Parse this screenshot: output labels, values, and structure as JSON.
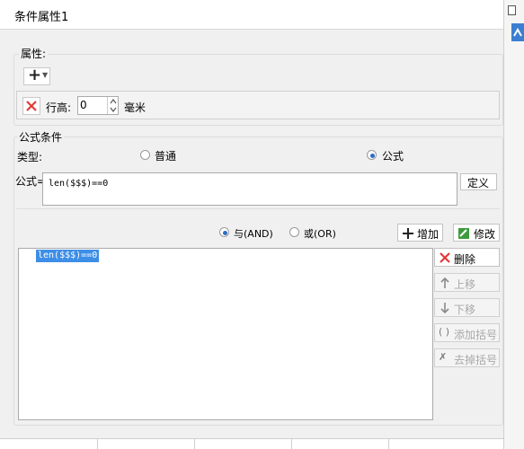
{
  "window": {
    "title": "条件属性1"
  },
  "properties": {
    "group_label": "属性:",
    "row_height_label": "行高:",
    "row_height_value": "0",
    "unit_label": "毫米"
  },
  "formula_condition": {
    "group_label": "公式条件",
    "type_label": "类型:",
    "type_options": [
      {
        "label": "普通",
        "selected": false
      },
      {
        "label": "公式",
        "selected": true
      }
    ],
    "formula_label": "公式=",
    "formula_value": "len($$$)==0",
    "define_button": "定义",
    "logic_options": [
      {
        "label": "与(AND)",
        "selected": true
      },
      {
        "label": "或(OR)",
        "selected": false
      }
    ],
    "add_button": "增加",
    "modify_button": "修改",
    "conditions": [
      "len($$$)==0"
    ],
    "side_buttons": [
      {
        "label": "删除",
        "enabled": true,
        "icon": "red-x-icon"
      },
      {
        "label": "上移",
        "enabled": false,
        "icon": "arrow-up-icon"
      },
      {
        "label": "下移",
        "enabled": false,
        "icon": "arrow-down-icon"
      },
      {
        "label": "添加括号",
        "enabled": false,
        "icon": "parentheses-icon"
      },
      {
        "label": "去掉括号",
        "enabled": false,
        "icon": "remove-parentheses-icon"
      }
    ]
  },
  "colors": {
    "accent": "#3d8ee6",
    "delete_red": "#e53935",
    "radio_dot": "#2a6dc7"
  }
}
